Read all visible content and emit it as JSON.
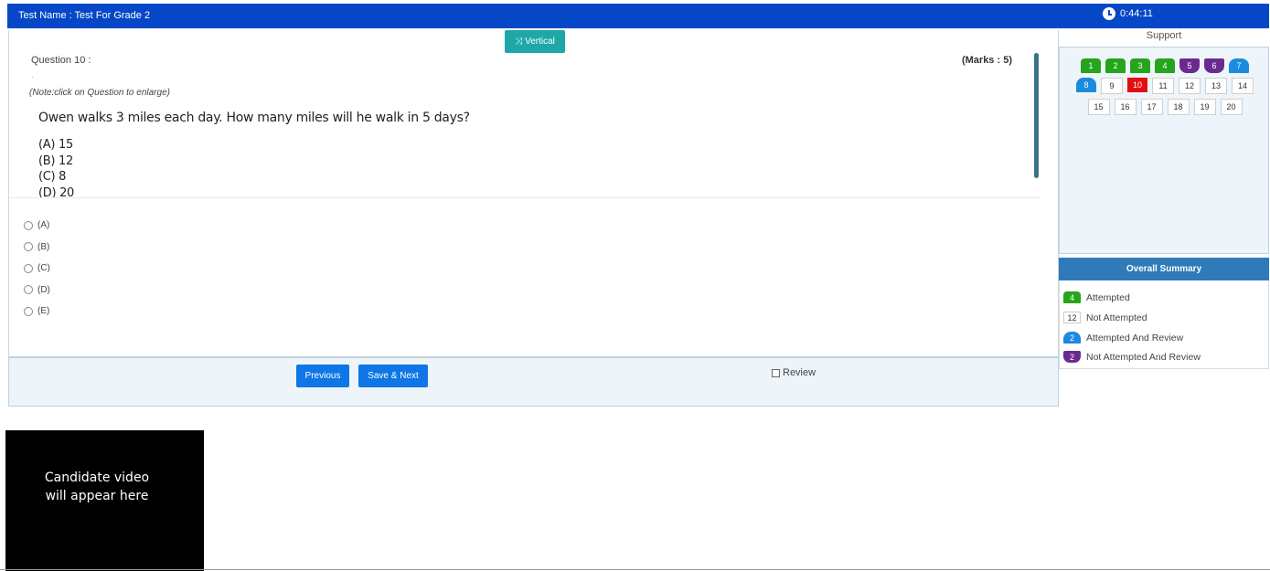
{
  "header": {
    "test_name": "Test Name : Test For Grade 2",
    "timer": "0:44:11"
  },
  "question": {
    "layout_button": "Vertical",
    "label": "Question 10 :",
    "marks": "(Marks : 5)",
    "separator": ".",
    "note": "(Note:click on Question to enlarge)",
    "text": "Owen walks 3 miles each day. How many miles will he walk in 5 days?",
    "options": [
      "(A) 15",
      "(B) 12",
      "(C) 8",
      "(D) 20"
    ]
  },
  "answers": [
    "(A)",
    "(B)",
    "(C)",
    "(D)",
    "(E)"
  ],
  "footer": {
    "previous_label": "Previous",
    "save_next_label": "Save & Next",
    "review_label": "Review"
  },
  "video": {
    "text": "Candidate video\nwill appear here"
  },
  "sidebar": {
    "support": "Support",
    "palette_rows": [
      [
        {
          "n": "1",
          "s": "att"
        },
        {
          "n": "2",
          "s": "att"
        },
        {
          "n": "3",
          "s": "att"
        },
        {
          "n": "4",
          "s": "att"
        },
        {
          "n": "5",
          "s": "natr"
        },
        {
          "n": "6",
          "s": "natr"
        },
        {
          "n": "7",
          "s": "atr"
        }
      ],
      [
        {
          "n": "8",
          "s": "atr"
        },
        {
          "n": "9",
          "s": "sq"
        },
        {
          "n": "10",
          "s": "cur"
        },
        {
          "n": "11",
          "s": "sq"
        },
        {
          "n": "12",
          "s": "sq"
        },
        {
          "n": "13",
          "s": "sq"
        },
        {
          "n": "14",
          "s": "sq"
        }
      ],
      [
        {
          "n": "15",
          "s": "sq"
        },
        {
          "n": "16",
          "s": "sq"
        },
        {
          "n": "17",
          "s": "sq"
        },
        {
          "n": "18",
          "s": "sq"
        },
        {
          "n": "19",
          "s": "sq"
        },
        {
          "n": "20",
          "s": "sq"
        }
      ]
    ],
    "summary_title": "Overall Summary",
    "summary": {
      "attempted_count": "4",
      "attempted_label": "Attempted",
      "not_attempted_count": "12",
      "not_attempted_label": "Not Attempted",
      "attempted_review_count": "2",
      "attempted_review_label": "Attempted And Review",
      "not_attempted_review_count": "2",
      "not_attempted_review_label": "Not Attempted And Review"
    }
  },
  "colors": {
    "header_bg": "#0547c6",
    "attempted": "#25a41c",
    "not_attempted_review": "#6b2b8e",
    "attempted_review": "#1c8ade",
    "current": "#e20f0f",
    "primary_button": "#0e76e6"
  }
}
